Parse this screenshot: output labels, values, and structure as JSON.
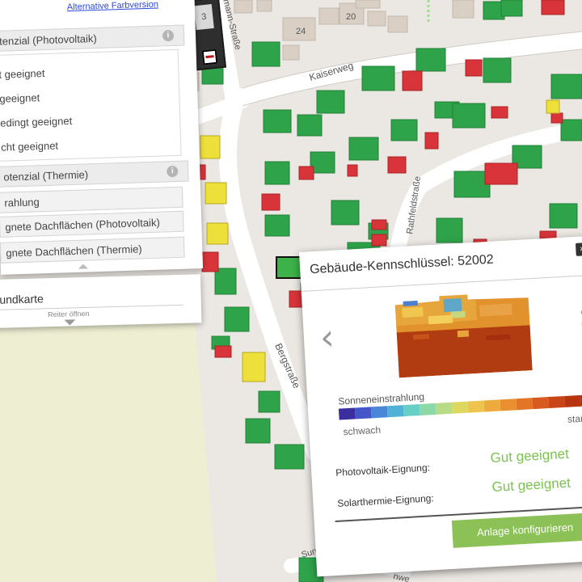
{
  "map": {
    "streets": {
      "kaiserweg": "Kaiserweg",
      "bergstrasse": "Bergstraße",
      "rathfeldstrasse": "Rathfeldstraße",
      "top_street_fragment": "mann-Straße",
      "bottom_left_fragment": "Sun",
      "bottom_right_fragment": "nwe"
    },
    "house_numbers": [
      "24",
      "20"
    ],
    "zoom_level_text": "3"
  },
  "left_panel": {
    "alt_color_link": "Alternative Farbversion",
    "pv_header": "tenzial (Photovoltaik)",
    "options": [
      "t geeignet",
      "geeignet",
      "edingt geeignet",
      "cht geeignet"
    ],
    "thermie_header": "otenzial (Thermie)",
    "radiation_item": "rahlung",
    "pv_roofs_item": "gnete Dachflächen (Photovoltaik)",
    "thermie_roofs_item": "gnete Dachflächen (Thermie)",
    "info_glyph": "i"
  },
  "basemap_panel": {
    "label": "rundkarte",
    "tab_open": "Reiter öffnen"
  },
  "popup": {
    "title": "Gebäude-Kennschlüssel: 52002",
    "close_glyph": "×",
    "prev_glyph": "‹",
    "next_glyph": "›",
    "scale_title": "Sonneneinstrahlung",
    "scale_weak": "schwach",
    "scale_strong": "star",
    "pv_label": "Photovoltaik-Eignung:",
    "pv_value": "Gut geeignet",
    "st_label": "Solarthermie-Eignung:",
    "st_value": "Gut geeignet",
    "configure_button": "Anlage konfigurieren"
  },
  "colors": {
    "suitable": "#2fa34a",
    "unsuitable": "#d9343a",
    "conditional": "#ede03a",
    "accent_green": "#7cc352",
    "button": "#8bc157",
    "scale": [
      "#3b2fa0",
      "#4556c8",
      "#4a87d8",
      "#52b1d6",
      "#66cfc6",
      "#8bd8a8",
      "#b8dc86",
      "#dfd860",
      "#eec44c",
      "#eeab3c",
      "#ea9030",
      "#e37526",
      "#d85a1e",
      "#c94416",
      "#b83512",
      "#a82b10"
    ]
  }
}
